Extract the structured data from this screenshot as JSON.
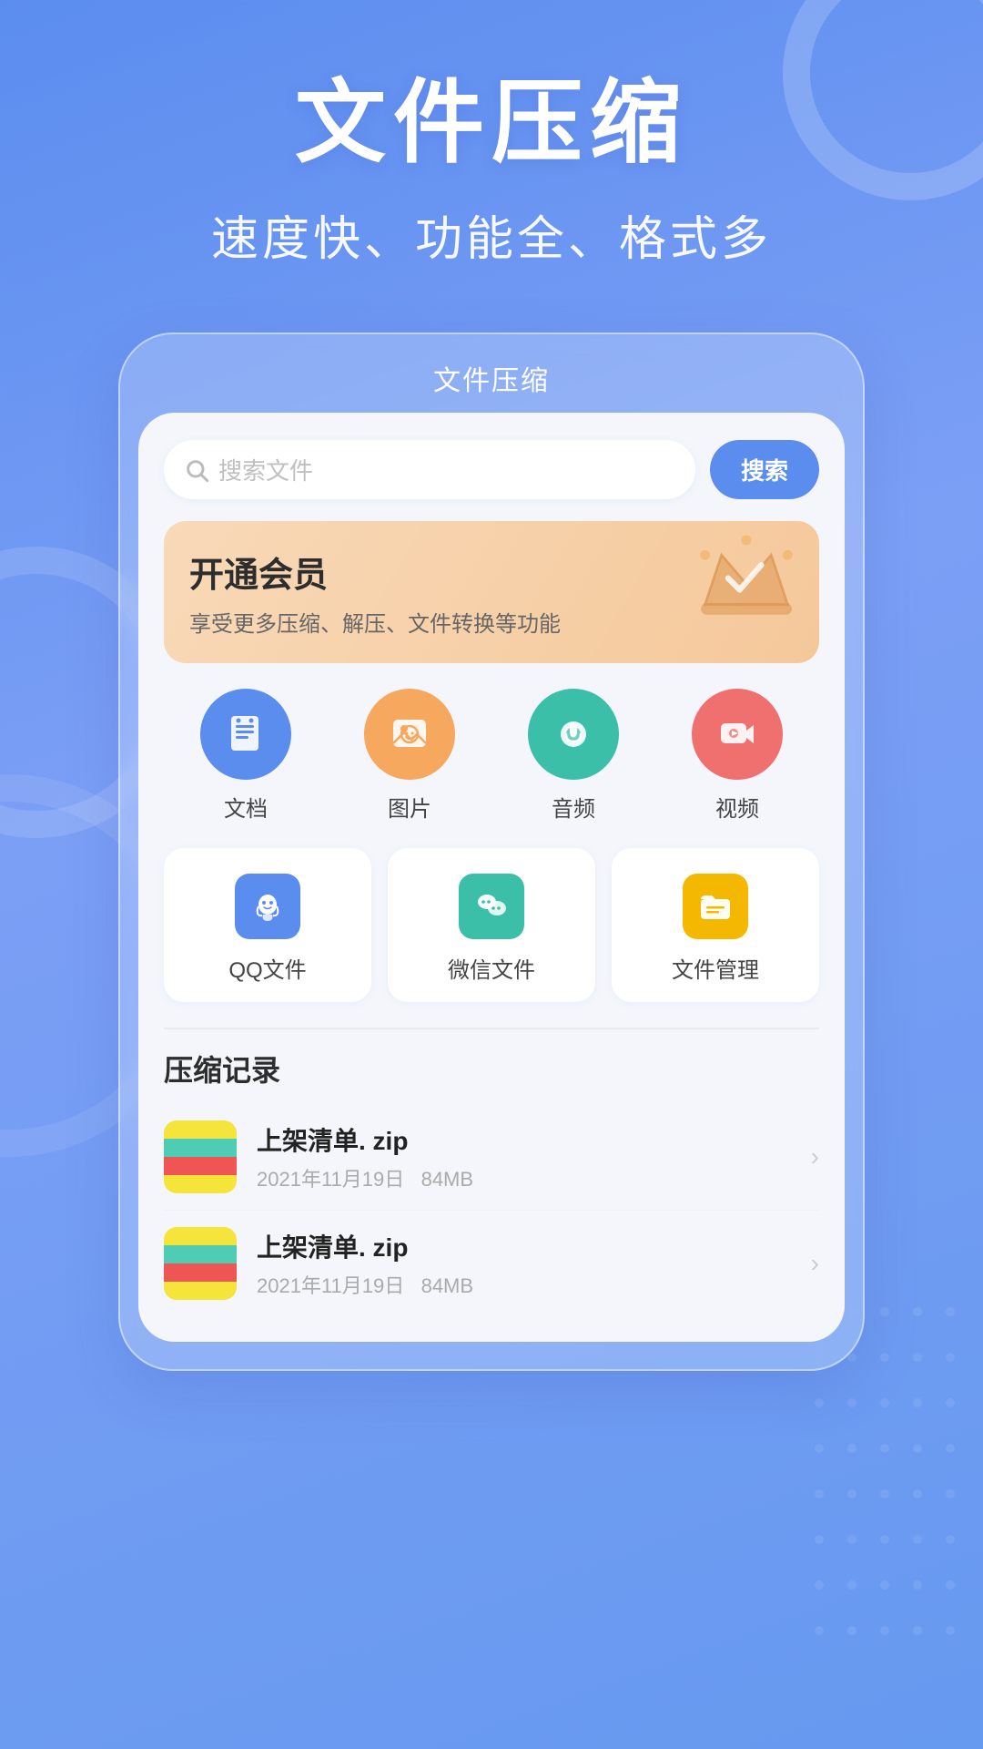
{
  "page": {
    "background_gradient": "linear-gradient(160deg, #5b8def 0%, #7b9ff5 40%, #6699f0 100%)"
  },
  "header": {
    "main_title": "文件压缩",
    "sub_title": "速度快、功能全、格式多"
  },
  "mockup": {
    "title": "文件压缩"
  },
  "search": {
    "placeholder": "搜索文件",
    "button_label": "搜索"
  },
  "vip_banner": {
    "title": "开通会员",
    "description": "享受更多压缩、解压、文件转换等功能"
  },
  "categories": [
    {
      "id": "doc",
      "label": "文档",
      "icon": "📄",
      "color_class": "cat-icon-doc"
    },
    {
      "id": "img",
      "label": "图片",
      "icon": "🖼",
      "color_class": "cat-icon-img"
    },
    {
      "id": "audio",
      "label": "音频",
      "icon": "🎙",
      "color_class": "cat-icon-audio"
    },
    {
      "id": "video",
      "label": "视频",
      "icon": "📹",
      "color_class": "cat-icon-video"
    }
  ],
  "file_sources": [
    {
      "id": "qq",
      "label": "QQ文件",
      "icon": "🐧",
      "color_class": "fs-qq"
    },
    {
      "id": "wechat",
      "label": "微信文件",
      "icon": "💬",
      "color_class": "fs-wx"
    },
    {
      "id": "manager",
      "label": "文件管理",
      "icon": "📁",
      "color_class": "fs-mgr"
    }
  ],
  "records": {
    "section_title": "压缩记录",
    "items": [
      {
        "name": "上架清单. zip",
        "date": "2021年11月19日",
        "size": "84MB"
      },
      {
        "name": "上架清单. zip",
        "date": "2021年11月19日",
        "size": "84MB"
      }
    ]
  }
}
